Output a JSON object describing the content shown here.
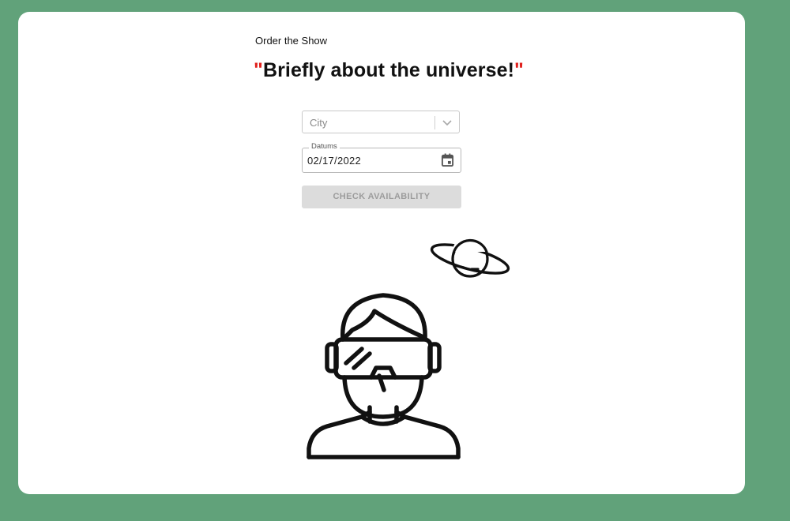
{
  "header": {
    "subtitle": "Order the Show",
    "title_open_quote": "\"",
    "title_text": "Briefly about the universe!",
    "title_close_quote": "\""
  },
  "form": {
    "city": {
      "placeholder": "City",
      "icon": "chevron-down-icon"
    },
    "date": {
      "label": "Datums",
      "value": "02/17/2022",
      "icon": "calendar-icon"
    },
    "check_button_label": "CHECK AVAILABILITY"
  },
  "illustrations": {
    "planet": "planet-icon",
    "person": "vr-headset-person-icon"
  },
  "colors": {
    "background": "#61a27a",
    "card": "#ffffff",
    "quote_accent": "#e0201c",
    "disabled_button": "#dcdcdc"
  }
}
